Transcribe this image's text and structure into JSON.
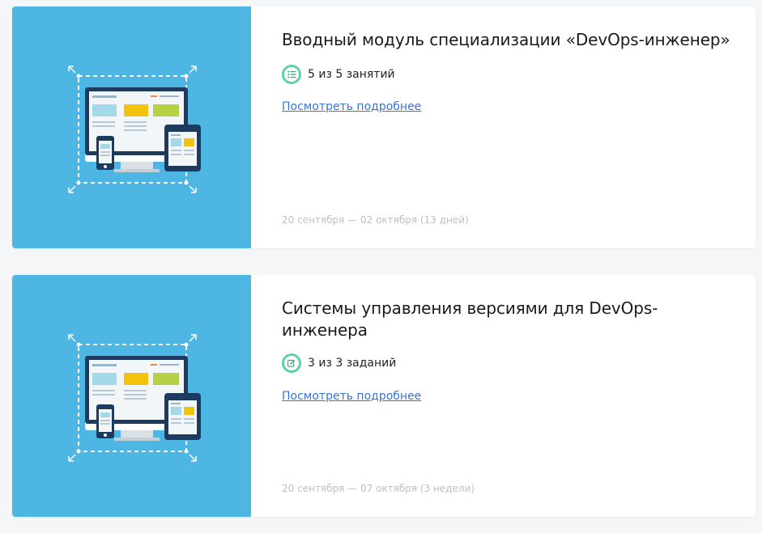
{
  "courses": [
    {
      "title": "Вводный модуль специализации «DevOps-инженер»",
      "progress_icon": "list-icon",
      "progress_text": "5 из 5 занятий",
      "more_link": "Посмотреть подробнее",
      "dates": "20 сентября — 02 октября (13 дней)"
    },
    {
      "title": "Системы управления версиями для DevOps-инженера",
      "progress_icon": "edit-icon",
      "progress_text": "3 из 3 заданий",
      "more_link": "Посмотреть подробнее",
      "dates": "20 сентября — 07 октября (3 недели)"
    }
  ],
  "colors": {
    "thumb_background": "#4db6e2",
    "badge_ring": "#5fd1a6",
    "link": "#3475d9",
    "dates": "#bcbfc4"
  }
}
